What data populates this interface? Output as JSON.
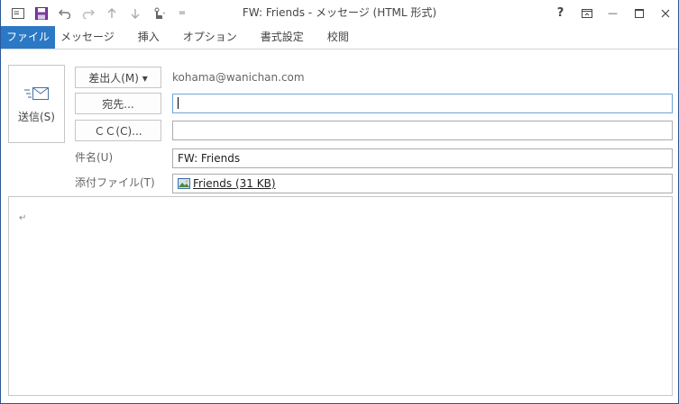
{
  "window": {
    "title": "FW: Friends - メッセージ (HTML 形式)"
  },
  "qat": {
    "customize_label": "="
  },
  "window_controls": {
    "help_label": "?",
    "minimize_label": "—"
  },
  "tabs": [
    {
      "label": "ファイル"
    },
    {
      "label": "メッセージ"
    },
    {
      "label": "挿入"
    },
    {
      "label": "オプション"
    },
    {
      "label": "書式設定"
    },
    {
      "label": "校閲"
    }
  ],
  "compose": {
    "send_label": "送信(S)",
    "from_button": "差出人(M) ▾",
    "from_value": "kohama@wanichan.com",
    "to_button": "宛先...",
    "to_value": "",
    "cc_button": "ＣＣ(C)...",
    "cc_value": "",
    "subject_label": "件名(U)",
    "subject_value": "FW: Friends",
    "attach_label": "添付ファイル(T)",
    "attachment_name": "Friends (31 KB)"
  },
  "body": {
    "paragraph_mark": "↵"
  }
}
